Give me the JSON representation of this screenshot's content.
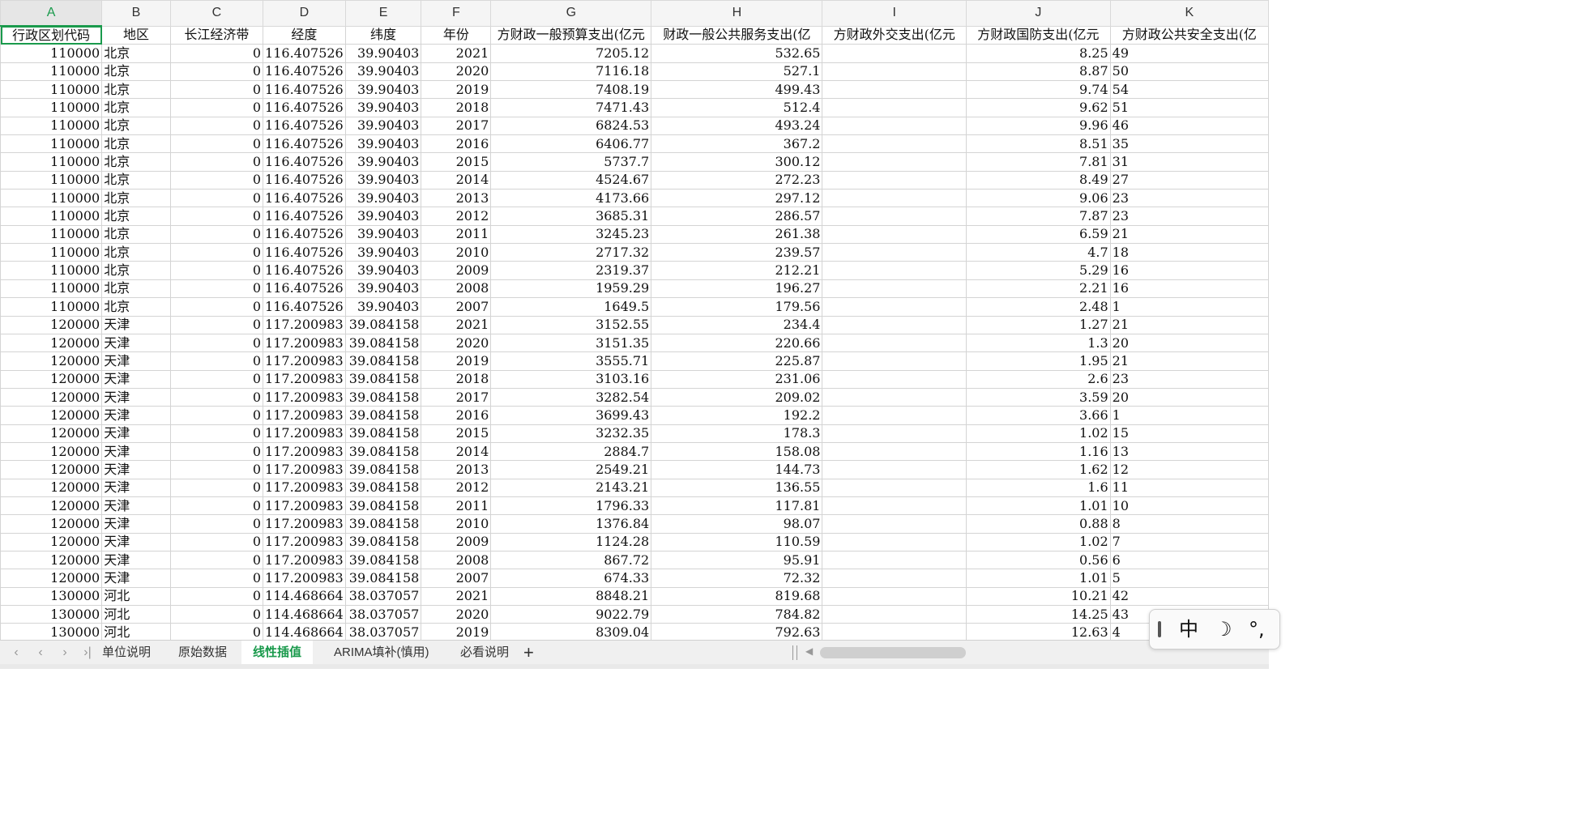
{
  "columns": [
    {
      "letter": "A",
      "width": 130
    },
    {
      "letter": "B",
      "width": 94
    },
    {
      "letter": "C",
      "width": 120
    },
    {
      "letter": "D",
      "width": 94
    },
    {
      "letter": "E",
      "width": 94
    },
    {
      "letter": "F",
      "width": 94
    },
    {
      "letter": "G",
      "width": 200
    },
    {
      "letter": "H",
      "width": 216
    },
    {
      "letter": "I",
      "width": 182
    },
    {
      "letter": "J",
      "width": 182
    },
    {
      "letter": "K",
      "width": 200
    }
  ],
  "header_row": [
    "行政区划代码",
    "地区",
    "长江经济带",
    "经度",
    "纬度",
    "年份",
    "方财政一般预算支出(亿元",
    "财政一般公共服务支出(亿",
    "方财政外交支出(亿元",
    "方财政国防支出(亿元",
    "方财政公共安全支出(亿"
  ],
  "rows": [
    [
      "110000",
      "北京",
      "0",
      "116.407526",
      "39.90403",
      "2021",
      "7205.12",
      "532.65",
      "",
      "8.25",
      "49"
    ],
    [
      "110000",
      "北京",
      "0",
      "116.407526",
      "39.90403",
      "2020",
      "7116.18",
      "527.1",
      "",
      "8.87",
      "50"
    ],
    [
      "110000",
      "北京",
      "0",
      "116.407526",
      "39.90403",
      "2019",
      "7408.19",
      "499.43",
      "",
      "9.74",
      "54"
    ],
    [
      "110000",
      "北京",
      "0",
      "116.407526",
      "39.90403",
      "2018",
      "7471.43",
      "512.4",
      "",
      "9.62",
      "51"
    ],
    [
      "110000",
      "北京",
      "0",
      "116.407526",
      "39.90403",
      "2017",
      "6824.53",
      "493.24",
      "",
      "9.96",
      "46"
    ],
    [
      "110000",
      "北京",
      "0",
      "116.407526",
      "39.90403",
      "2016",
      "6406.77",
      "367.2",
      "",
      "8.51",
      "35"
    ],
    [
      "110000",
      "北京",
      "0",
      "116.407526",
      "39.90403",
      "2015",
      "5737.7",
      "300.12",
      "",
      "7.81",
      "31"
    ],
    [
      "110000",
      "北京",
      "0",
      "116.407526",
      "39.90403",
      "2014",
      "4524.67",
      "272.23",
      "",
      "8.49",
      "27"
    ],
    [
      "110000",
      "北京",
      "0",
      "116.407526",
      "39.90403",
      "2013",
      "4173.66",
      "297.12",
      "",
      "9.06",
      "23"
    ],
    [
      "110000",
      "北京",
      "0",
      "116.407526",
      "39.90403",
      "2012",
      "3685.31",
      "286.57",
      "",
      "7.87",
      "23"
    ],
    [
      "110000",
      "北京",
      "0",
      "116.407526",
      "39.90403",
      "2011",
      "3245.23",
      "261.38",
      "",
      "6.59",
      "21"
    ],
    [
      "110000",
      "北京",
      "0",
      "116.407526",
      "39.90403",
      "2010",
      "2717.32",
      "239.57",
      "",
      "4.7",
      "18"
    ],
    [
      "110000",
      "北京",
      "0",
      "116.407526",
      "39.90403",
      "2009",
      "2319.37",
      "212.21",
      "",
      "5.29",
      "16"
    ],
    [
      "110000",
      "北京",
      "0",
      "116.407526",
      "39.90403",
      "2008",
      "1959.29",
      "196.27",
      "",
      "2.21",
      "16"
    ],
    [
      "110000",
      "北京",
      "0",
      "116.407526",
      "39.90403",
      "2007",
      "1649.5",
      "179.56",
      "",
      "2.48",
      "1"
    ],
    [
      "120000",
      "天津",
      "0",
      "117.200983",
      "39.084158",
      "2021",
      "3152.55",
      "234.4",
      "",
      "1.27",
      "21"
    ],
    [
      "120000",
      "天津",
      "0",
      "117.200983",
      "39.084158",
      "2020",
      "3151.35",
      "220.66",
      "",
      "1.3",
      "20"
    ],
    [
      "120000",
      "天津",
      "0",
      "117.200983",
      "39.084158",
      "2019",
      "3555.71",
      "225.87",
      "",
      "1.95",
      "21"
    ],
    [
      "120000",
      "天津",
      "0",
      "117.200983",
      "39.084158",
      "2018",
      "3103.16",
      "231.06",
      "",
      "2.6",
      "23"
    ],
    [
      "120000",
      "天津",
      "0",
      "117.200983",
      "39.084158",
      "2017",
      "3282.54",
      "209.02",
      "",
      "3.59",
      "20"
    ],
    [
      "120000",
      "天津",
      "0",
      "117.200983",
      "39.084158",
      "2016",
      "3699.43",
      "192.2",
      "",
      "3.66",
      "1"
    ],
    [
      "120000",
      "天津",
      "0",
      "117.200983",
      "39.084158",
      "2015",
      "3232.35",
      "178.3",
      "",
      "1.02",
      "15"
    ],
    [
      "120000",
      "天津",
      "0",
      "117.200983",
      "39.084158",
      "2014",
      "2884.7",
      "158.08",
      "",
      "1.16",
      "13"
    ],
    [
      "120000",
      "天津",
      "0",
      "117.200983",
      "39.084158",
      "2013",
      "2549.21",
      "144.73",
      "",
      "1.62",
      "12"
    ],
    [
      "120000",
      "天津",
      "0",
      "117.200983",
      "39.084158",
      "2012",
      "2143.21",
      "136.55",
      "",
      "1.6",
      "11"
    ],
    [
      "120000",
      "天津",
      "0",
      "117.200983",
      "39.084158",
      "2011",
      "1796.33",
      "117.81",
      "",
      "1.01",
      "10"
    ],
    [
      "120000",
      "天津",
      "0",
      "117.200983",
      "39.084158",
      "2010",
      "1376.84",
      "98.07",
      "",
      "0.88",
      "8"
    ],
    [
      "120000",
      "天津",
      "0",
      "117.200983",
      "39.084158",
      "2009",
      "1124.28",
      "110.59",
      "",
      "1.02",
      "7"
    ],
    [
      "120000",
      "天津",
      "0",
      "117.200983",
      "39.084158",
      "2008",
      "867.72",
      "95.91",
      "",
      "0.56",
      "6"
    ],
    [
      "120000",
      "天津",
      "0",
      "117.200983",
      "39.084158",
      "2007",
      "674.33",
      "72.32",
      "",
      "1.01",
      "5"
    ],
    [
      "130000",
      "河北",
      "0",
      "114.468664",
      "38.037057",
      "2021",
      "8848.21",
      "819.68",
      "",
      "10.21",
      "42"
    ],
    [
      "130000",
      "河北",
      "0",
      "114.468664",
      "38.037057",
      "2020",
      "9022.79",
      "784.82",
      "",
      "14.25",
      "43"
    ],
    [
      "130000",
      "河北",
      "0",
      "114.468664",
      "38.037057",
      "2019",
      "8309.04",
      "792.63",
      "",
      "12.63",
      "4"
    ]
  ],
  "sheet_tabs": [
    "单位说明",
    "原始数据",
    "线性插值",
    "ARIMA填补(慎用)",
    "必看说明"
  ],
  "active_sheet": "线性插值",
  "nav": {
    "first": "⟨",
    "prev": "⟨",
    "next": "⟩",
    "last": "⟩|",
    "add": "+"
  },
  "ime": {
    "grip": "",
    "lang": "中",
    "moon": "☽",
    "punct": "°,"
  },
  "colors": {
    "accent": "#1a9a4c",
    "header_bg": "#f5f5f5",
    "grid_line": "#d4d4d4"
  }
}
